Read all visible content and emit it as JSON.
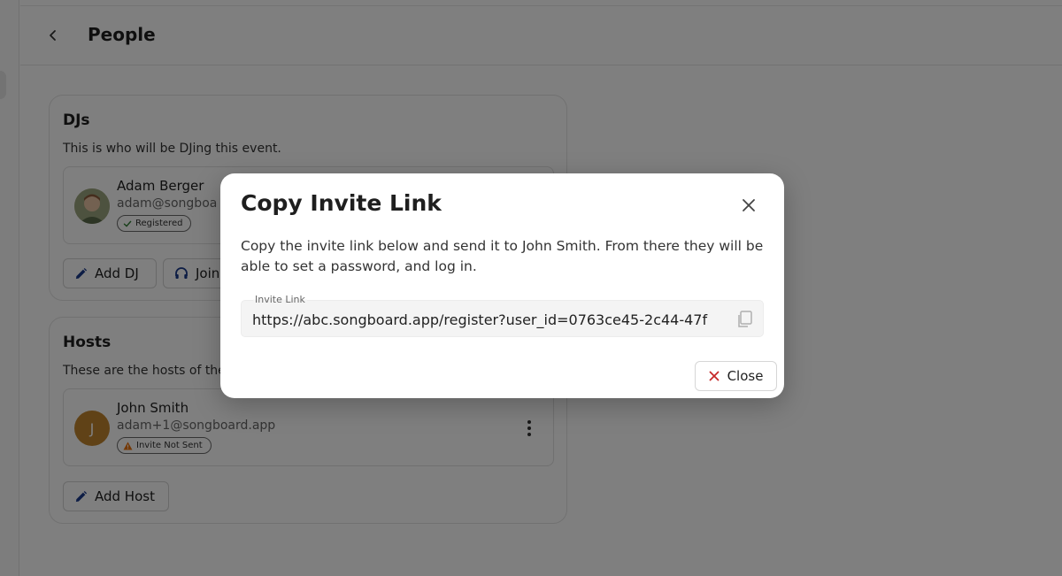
{
  "header": {
    "title": "People"
  },
  "djs": {
    "title": "DJs",
    "description": "This is who will be DJing this event.",
    "person": {
      "name": "Adam Berger",
      "email": "adam@songboa",
      "status": "Registered"
    },
    "add_button": "Add DJ",
    "join_button": "Join"
  },
  "hosts": {
    "title": "Hosts",
    "description": "These are the hosts of the",
    "person": {
      "initial": "J",
      "name": "John Smith",
      "email": "adam+1@songboard.app",
      "status": "Invite Not Sent"
    },
    "add_button": "Add Host"
  },
  "dialog": {
    "title": "Copy Invite Link",
    "text": "Copy the invite link below and send it to John Smith. From there they will be able to set a password, and log in.",
    "field_label": "Invite Link",
    "field_value": "https://abc.songboard.app/register?user_id=0763ce45-2c44-47f",
    "close_label": "Close"
  },
  "colors": {
    "accent_red": "#c62828",
    "warning_orange": "#e8710a",
    "registered_green": "#2e7d32",
    "backdrop": "rgba(0,0,0,0.5)"
  },
  "icons": {
    "back": "chevron-left-icon",
    "close": "close-icon",
    "copy": "copy-icon",
    "edit": "pencil-icon",
    "join": "headphones-icon",
    "registered": "check-icon",
    "warning": "warning-icon",
    "menu": "kebab-menu-icon"
  }
}
